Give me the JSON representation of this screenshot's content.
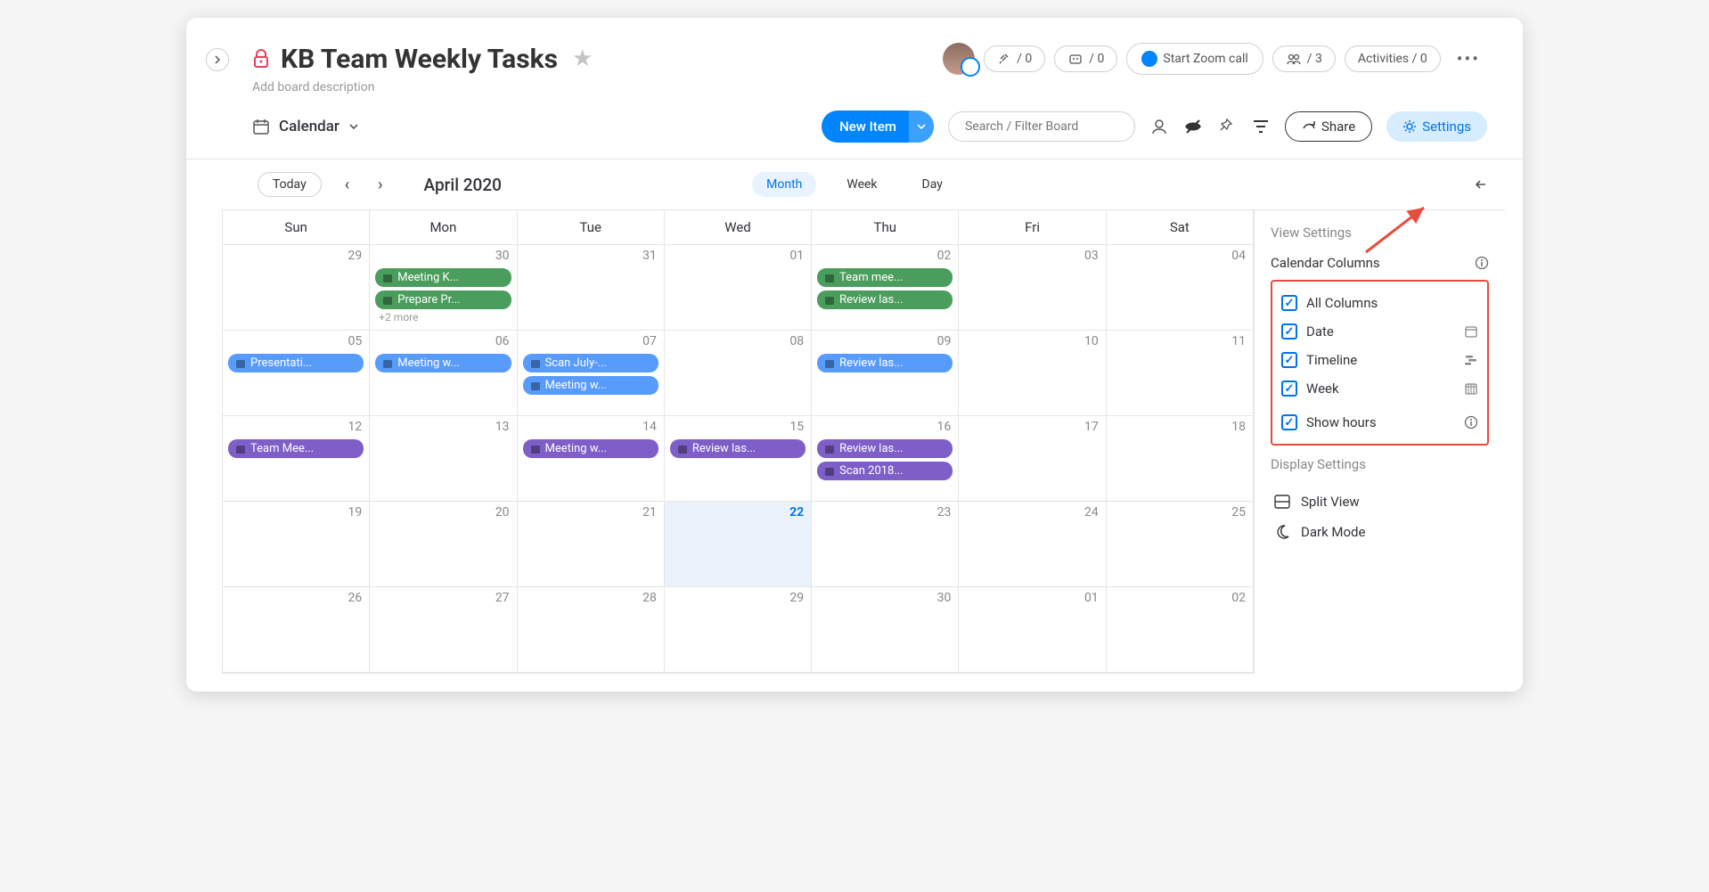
{
  "header": {
    "title": "KB Team Weekly Tasks",
    "description": "Add board description",
    "integrations_count": "/ 0",
    "automations_count": "/ 0",
    "zoom_label": "Start Zoom call",
    "people_count": "/ 3",
    "activities_label": "Activities / 0"
  },
  "toolbar": {
    "view_name": "Calendar",
    "new_item": "New Item",
    "search_placeholder": "Search / Filter Board",
    "share": "Share",
    "settings": "Settings"
  },
  "calendar": {
    "today": "Today",
    "month_label": "April 2020",
    "tabs": {
      "month": "Month",
      "week": "Week",
      "day": "Day"
    },
    "day_headers": [
      "Sun",
      "Mon",
      "Tue",
      "Wed",
      "Thu",
      "Fri",
      "Sat"
    ],
    "cells": [
      {
        "num": "29"
      },
      {
        "num": "30",
        "events": [
          {
            "c": "green",
            "t": "Meeting K..."
          },
          {
            "c": "green",
            "t": "Prepare Pr..."
          }
        ],
        "more": "+2 more"
      },
      {
        "num": "31"
      },
      {
        "num": "01"
      },
      {
        "num": "02",
        "events": [
          {
            "c": "green",
            "t": "Team mee..."
          },
          {
            "c": "green",
            "t": "Review las..."
          }
        ]
      },
      {
        "num": "03"
      },
      {
        "num": "04"
      },
      {
        "num": "05",
        "events": [
          {
            "c": "blue",
            "t": "Presentati..."
          }
        ]
      },
      {
        "num": "06",
        "events": [
          {
            "c": "blue",
            "t": "Meeting w..."
          }
        ]
      },
      {
        "num": "07",
        "events": [
          {
            "c": "blue",
            "t": "Scan July-..."
          },
          {
            "c": "blue",
            "t": "Meeting w..."
          }
        ]
      },
      {
        "num": "08"
      },
      {
        "num": "09",
        "events": [
          {
            "c": "blue",
            "t": "Review las..."
          }
        ]
      },
      {
        "num": "10"
      },
      {
        "num": "11"
      },
      {
        "num": "12",
        "events": [
          {
            "c": "purple",
            "t": "Team Mee..."
          }
        ]
      },
      {
        "num": "13"
      },
      {
        "num": "14",
        "events": [
          {
            "c": "purple",
            "t": "Meeting w..."
          }
        ]
      },
      {
        "num": "15",
        "events": [
          {
            "c": "purple",
            "t": "Review las..."
          }
        ]
      },
      {
        "num": "16",
        "events": [
          {
            "c": "purple",
            "t": "Review las..."
          },
          {
            "c": "purple",
            "t": "Scan 2018..."
          }
        ]
      },
      {
        "num": "17"
      },
      {
        "num": "18"
      },
      {
        "num": "19"
      },
      {
        "num": "20"
      },
      {
        "num": "21"
      },
      {
        "num": "22",
        "today": true
      },
      {
        "num": "23"
      },
      {
        "num": "24"
      },
      {
        "num": "25"
      },
      {
        "num": "26"
      },
      {
        "num": "27"
      },
      {
        "num": "28"
      },
      {
        "num": "29"
      },
      {
        "num": "30"
      },
      {
        "num": "01"
      },
      {
        "num": "02"
      }
    ]
  },
  "settings_panel": {
    "view_settings": "View Settings",
    "calendar_columns": "Calendar Columns",
    "columns": {
      "all": "All Columns",
      "date": "Date",
      "timeline": "Timeline",
      "week": "Week",
      "show_hours": "Show hours"
    },
    "display_settings": "Display Settings",
    "split_view": "Split View",
    "dark_mode": "Dark Mode"
  }
}
